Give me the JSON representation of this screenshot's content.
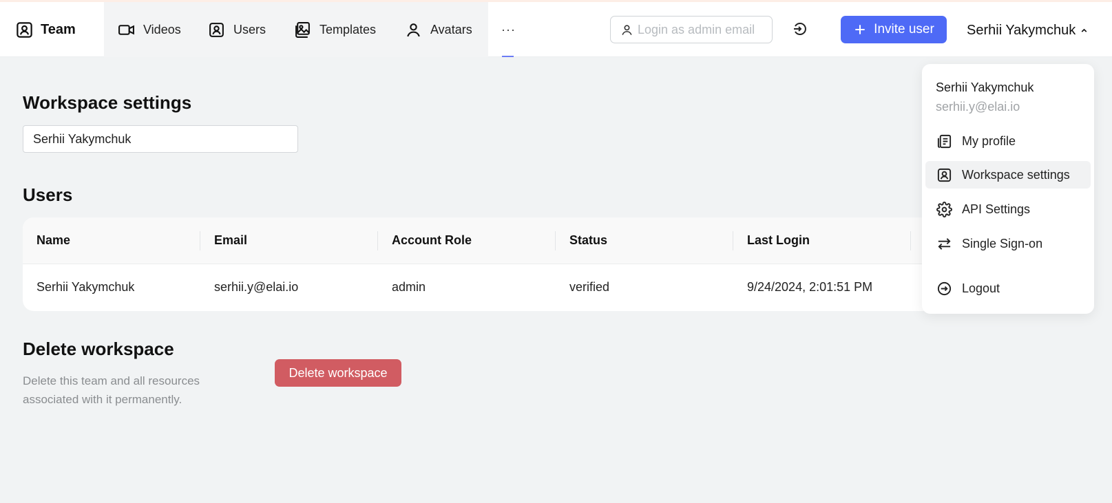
{
  "header": {
    "logo_label": "Team",
    "nav": [
      {
        "label": "Videos",
        "icon": "video-icon"
      },
      {
        "label": "Users",
        "icon": "users-icon"
      },
      {
        "label": "Templates",
        "icon": "templates-icon"
      },
      {
        "label": "Avatars",
        "icon": "avatar-icon"
      }
    ],
    "more_label": "···",
    "search_placeholder": "Login as admin email",
    "invite_label": "Invite user",
    "user_name": "Serhii Yakymchuk"
  },
  "workspace": {
    "title": "Workspace settings",
    "name_value": "Serhii Yakymchuk"
  },
  "users": {
    "title": "Users",
    "columns": [
      "Name",
      "Email",
      "Account Role",
      "Status",
      "Last Login"
    ],
    "rows": [
      [
        "Serhii Yakymchuk",
        "serhii.y@elai.io",
        "admin",
        "verified",
        "9/24/2024, 2:01:51 PM"
      ]
    ]
  },
  "delete": {
    "title": "Delete workspace",
    "description": "Delete this team and all resources associated with it permanently.",
    "button_label": "Delete workspace"
  },
  "dropdown": {
    "name": "Serhii Yakymchuk",
    "email": "serhii.y@elai.io",
    "items": [
      {
        "label": "My profile",
        "icon": "profile-icon"
      },
      {
        "label": "Workspace settings",
        "icon": "workspace-icon"
      },
      {
        "label": "API Settings",
        "icon": "gear-icon"
      },
      {
        "label": "Single Sign-on",
        "icon": "swap-arrows-icon"
      },
      {
        "label": "Logout",
        "icon": "logout-icon"
      }
    ]
  },
  "colors": {
    "accent": "#4e6af6",
    "danger": "#d15c62",
    "background": "#f1f3f4"
  }
}
